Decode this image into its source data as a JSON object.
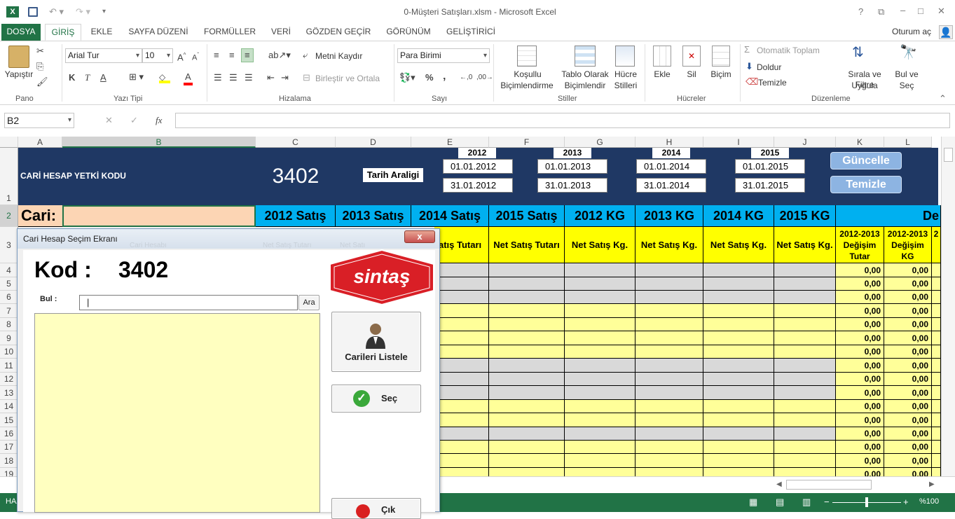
{
  "window": {
    "title": "0-Müşteri Satışları.xlsm - Microsoft Excel",
    "signin": "Oturum aç"
  },
  "tabs": [
    "DOSYA",
    "GİRİŞ",
    "EKLE",
    "SAYFA DÜZENİ",
    "FORMÜLLER",
    "VERİ",
    "GÖZDEN GEÇİR",
    "GÖRÜNÜM",
    "GELİŞTİRİCİ"
  ],
  "ribbon": {
    "pano": {
      "label": "Pano",
      "paste": "Yapıştır"
    },
    "font": {
      "label": "Yazı Tipi",
      "name": "Arial Tur",
      "size": "10",
      "bold": "K",
      "italic": "T",
      "underline": "A",
      "color": "A"
    },
    "align": {
      "label": "Hizalama",
      "wrap": "Metni Kaydır",
      "merge": "Birleştir ve Ortala"
    },
    "number": {
      "label": "Sayı",
      "format": "Para Birimi",
      "percent": "%",
      "comma": "‚"
    },
    "styles": {
      "label": "Stiller",
      "cond1": "Koşullu",
      "cond2": "Biçimlendirme",
      "table1": "Tablo Olarak",
      "table2": "Biçimlendir",
      "cell1": "Hücre",
      "cell2": "Stilleri"
    },
    "cells": {
      "label": "Hücreler",
      "insert": "Ekle",
      "delete": "Sil",
      "format": "Biçim"
    },
    "edit": {
      "label": "Düzenleme",
      "autosum": "Otomatik Toplam",
      "fill": "Doldur",
      "clear": "Temizle",
      "sort1": "Sırala ve Filtre",
      "sort2": "Uygula",
      "find1": "Bul ve",
      "find2": "Seç"
    }
  },
  "formula_bar": {
    "name_box": "B2",
    "fx": "fx",
    "value": ""
  },
  "columns": [
    "A",
    "B",
    "C",
    "D",
    "E",
    "F",
    "G",
    "H",
    "I",
    "J",
    "K",
    "L"
  ],
  "rows": [
    "1",
    "2",
    "3",
    "4",
    "5",
    "6",
    "7",
    "8",
    "9",
    "10",
    "11",
    "12",
    "13",
    "14",
    "15",
    "16",
    "17",
    "18",
    "19"
  ],
  "sheet": {
    "auth_label": "CARİ HESAP YETKİ KODU",
    "auth_code": "3402",
    "date_range_label": "Tarih Araligi",
    "years": [
      {
        "year": "2012",
        "start": "01.01.2012",
        "end": "31.01.2012"
      },
      {
        "year": "2013",
        "start": "01.01.2013",
        "end": "31.01.2013"
      },
      {
        "year": "2014",
        "start": "01.01.2014",
        "end": "31.01.2014"
      },
      {
        "year": "2015",
        "start": "01.01.2015",
        "end": "31.01.2015"
      }
    ],
    "update_button": "Güncelle",
    "clear_button": "Temizle",
    "cari_label": "Cari:",
    "row2_headers": [
      "2012 Satış",
      "2013 Satış",
      "2014 Satış",
      "2015 Satış",
      "2012 KG",
      "2013 KG",
      "2014 KG",
      "2015 KG",
      "De"
    ],
    "row3_headers": [
      "atış Tutarı",
      "Net Satış Tutarı",
      "Net Satış Kg.",
      "Net Satış Kg.",
      "Net Satış Kg.",
      "Net Satış Kg."
    ],
    "row3_change": [
      [
        "2012-2013",
        "Değişim",
        "Tutar"
      ],
      [
        "2012-2013",
        "Değişim",
        "KG"
      ],
      [
        "2"
      ]
    ],
    "change_values": [
      "0,00",
      "0,00",
      "0,00",
      "0,00",
      "0,00",
      "0,00",
      "0,00",
      "0,00",
      "0,00",
      "0,00",
      "0,00",
      "0,00",
      "0,00",
      "0,00",
      "0,00",
      "0,00"
    ]
  },
  "dialog": {
    "title": "Cari Hesap Seçim Ekranı",
    "close": "x",
    "code_label": "Kod :",
    "code_value": "3402",
    "logo": "sintaş",
    "find_label": "Bul :",
    "find_value": "|",
    "find_button": "Ara",
    "list_button": "Carileri Listele",
    "select_button": "Seç",
    "exit_button": "Çık",
    "ghost_headers": [
      "Cari Hesabı",
      "Net Satış Tutarı",
      "Net Satı"
    ]
  },
  "status": {
    "mode": "HAZ",
    "zoom": "%100"
  }
}
